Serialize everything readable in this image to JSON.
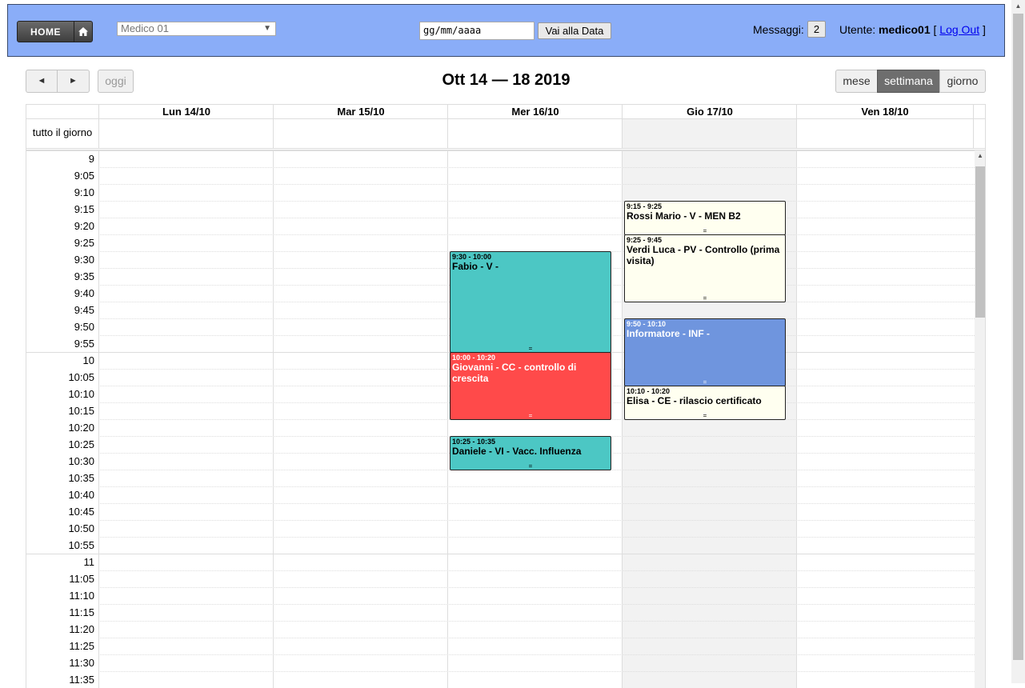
{
  "header": {
    "home_label": "HOME",
    "home_icon": "house-icon",
    "doctor_select": "Medico 01",
    "date_placeholder": "gg/mm/aaaa",
    "goto_label": "Vai alla Data",
    "messages_label": "Messaggi:",
    "messages_count": "2",
    "user_label": "Utente:",
    "user_name": "medico01",
    "logout_label": "Log Out",
    "bg_color": "#8aadf8"
  },
  "toolbar": {
    "prev_icon": "◄",
    "next_icon": "►",
    "today_label": "oggi",
    "title": "Ott 14 — 18 2019",
    "views": [
      "mese",
      "settimana",
      "giorno"
    ],
    "active_view": "settimana"
  },
  "calendar": {
    "allday_label": "tutto il giorno",
    "days": [
      "Lun 14/10",
      "Mar 15/10",
      "Mer 16/10",
      "Gio 17/10",
      "Ven 18/10"
    ],
    "today_index": 3,
    "slots": [
      "9",
      "9:05",
      "9:10",
      "9:15",
      "9:20",
      "9:25",
      "9:30",
      "9:35",
      "9:40",
      "9:45",
      "9:50",
      "9:55",
      "10",
      "10:05",
      "10:10",
      "10:15",
      "10:20",
      "10:25",
      "10:30",
      "10:35",
      "10:40",
      "10:45",
      "10:50",
      "10:55",
      "11",
      "11:05",
      "11:10",
      "11:15",
      "11:20",
      "11:25",
      "11:30",
      "11:35"
    ],
    "events": [
      {
        "day": 3,
        "start": "9:15",
        "end": "9:25",
        "time": "9:15 - 9:25",
        "title": "Rossi Mario - V - MEN B2",
        "color": "yellow"
      },
      {
        "day": 3,
        "start": "9:25",
        "end": "9:45",
        "time": "9:25 - 9:45",
        "title": "Verdi Luca - PV - Controllo (prima visita)",
        "color": "yellow"
      },
      {
        "day": 2,
        "start": "9:30",
        "end": "10:00",
        "time": "9:30 - 10:00",
        "title": "Fabio - V -",
        "color": "teal"
      },
      {
        "day": 3,
        "start": "9:50",
        "end": "10:10",
        "time": "9:50 - 10:10",
        "title": "Informatore - INF -",
        "color": "blue"
      },
      {
        "day": 2,
        "start": "10:00",
        "end": "10:20",
        "time": "10:00 - 10:20",
        "title": "Giovanni - CC - controllo di crescita",
        "color": "red"
      },
      {
        "day": 3,
        "start": "10:10",
        "end": "10:20",
        "time": "10:10 - 10:20",
        "title": "Elisa - CE - rilascio certificato",
        "color": "yellow"
      },
      {
        "day": 2,
        "start": "10:25",
        "end": "10:35",
        "time": "10:25 - 10:35",
        "title": "Daniele - VI - Vacc. Influenza",
        "color": "teal"
      }
    ],
    "event_colors": {
      "yellow": "#fffff0",
      "teal": "#4cc7c4",
      "red": "#ff4a4a",
      "blue": "#6f95de"
    },
    "handle_glyph": "="
  }
}
